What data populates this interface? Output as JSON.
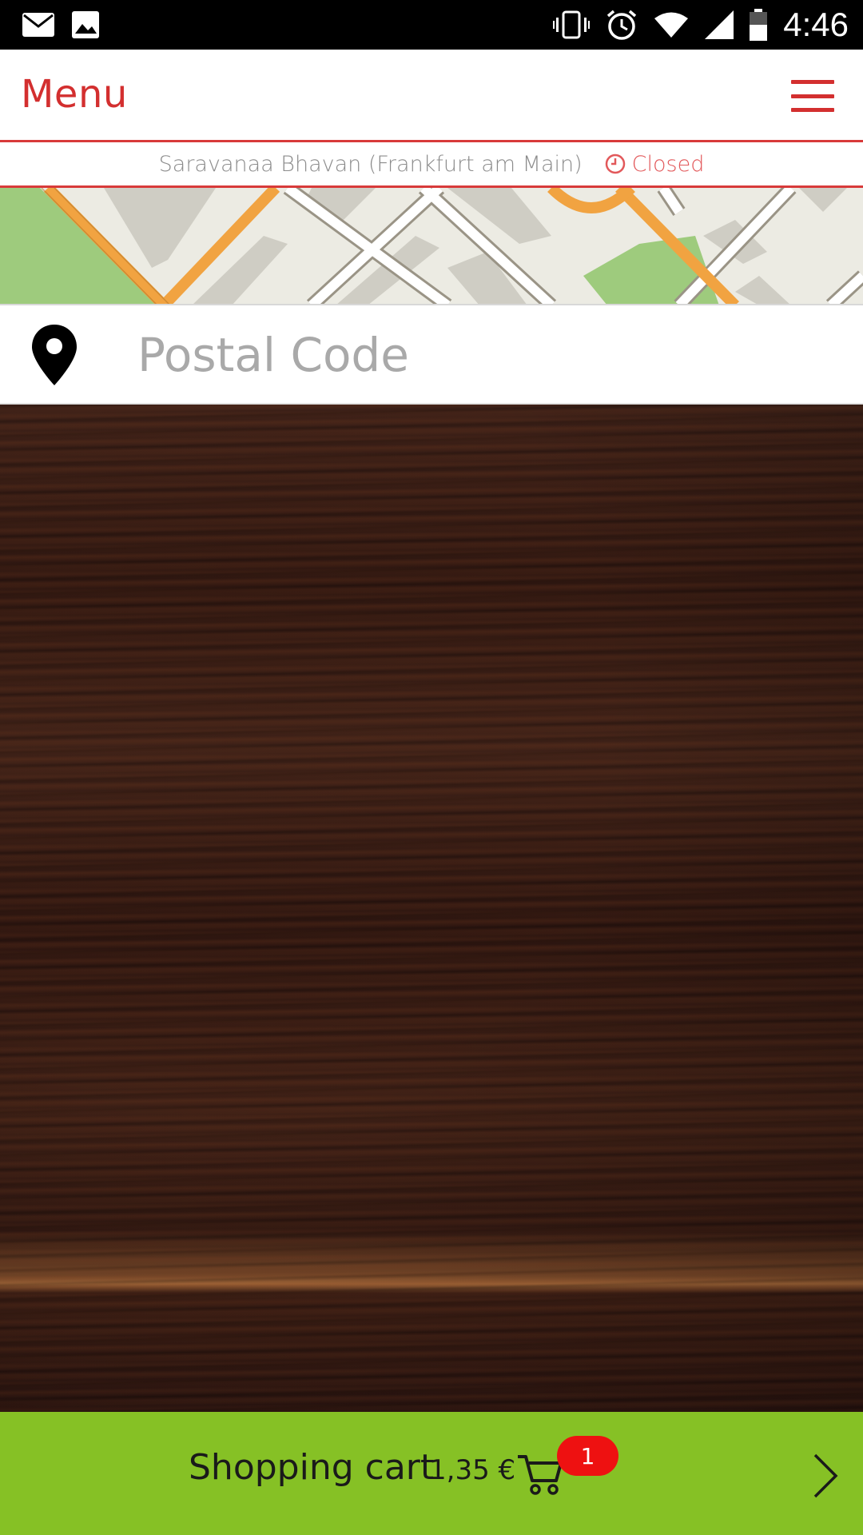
{
  "status_bar": {
    "time": "4:46",
    "icons": [
      "mail-icon",
      "image-icon",
      "vibrate-icon",
      "alarm-icon",
      "wifi-icon",
      "signal-icon",
      "battery-icon"
    ]
  },
  "header": {
    "title": "Menu",
    "menu_icon": "hamburger-menu-icon",
    "accent_color": "#d32f2f"
  },
  "restaurant": {
    "name": "Saravanaa Bhavan (Frankfurt am Main)",
    "status": "Closed",
    "status_icon": "clock-icon"
  },
  "postal_search": {
    "placeholder": "Postal Code",
    "value": "",
    "icon": "location-pin-icon"
  },
  "cart": {
    "label": "Shopping cart",
    "amount": "1,35 €",
    "badge_count": "1",
    "icon": "shopping-cart-icon",
    "arrow_icon": "chevron-right-icon",
    "bar_color": "#86c125",
    "badge_color": "#ee1111"
  }
}
